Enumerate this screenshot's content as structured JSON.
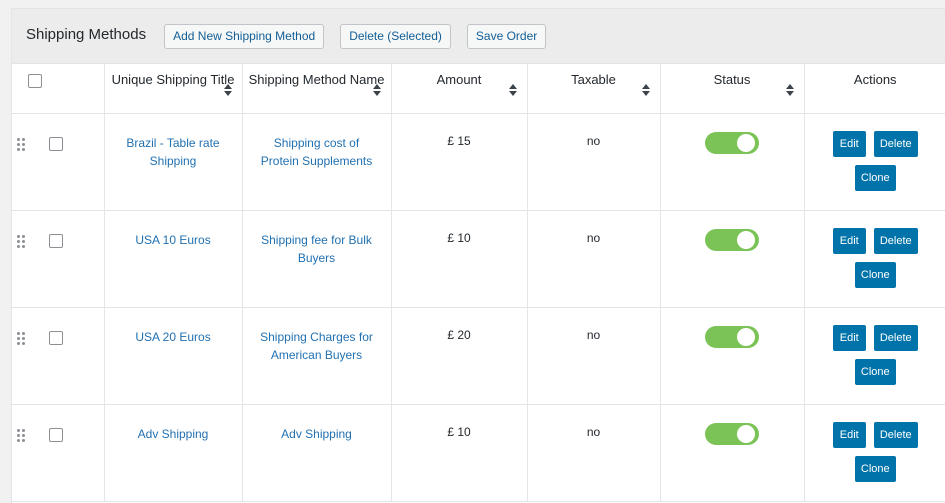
{
  "header": {
    "title": "Shipping Methods",
    "buttons": {
      "add_new": "Add New Shipping Method",
      "delete_selected": "Delete (Selected)",
      "save_order": "Save Order"
    }
  },
  "table": {
    "columns": {
      "title": "Unique Shipping Title",
      "name": "Shipping Method Name",
      "amount": "Amount",
      "taxable": "Taxable",
      "status": "Status",
      "actions": "Actions"
    },
    "action_labels": {
      "edit": "Edit",
      "delete": "Delete",
      "clone": "Clone"
    },
    "rows": [
      {
        "title": "Brazil - Table rate Shipping",
        "name": "Shipping cost of Protein Supplements",
        "amount": "£ 15",
        "taxable": "no",
        "status": "enabled"
      },
      {
        "title": "USA 10 Euros",
        "name": "Shipping fee for Bulk Buyers",
        "amount": "£ 10",
        "taxable": "no",
        "status": "enabled"
      },
      {
        "title": "USA 20 Euros",
        "name": "Shipping Charges for American Buyers",
        "amount": "£ 20",
        "taxable": "no",
        "status": "enabled"
      },
      {
        "title": "Adv Shipping",
        "name": "Adv Shipping",
        "amount": "£ 10",
        "taxable": "no",
        "status": "enabled"
      }
    ]
  },
  "colors": {
    "toggle_on": "#7bc356",
    "action_button": "#0073aa",
    "link": "#2271b1"
  }
}
